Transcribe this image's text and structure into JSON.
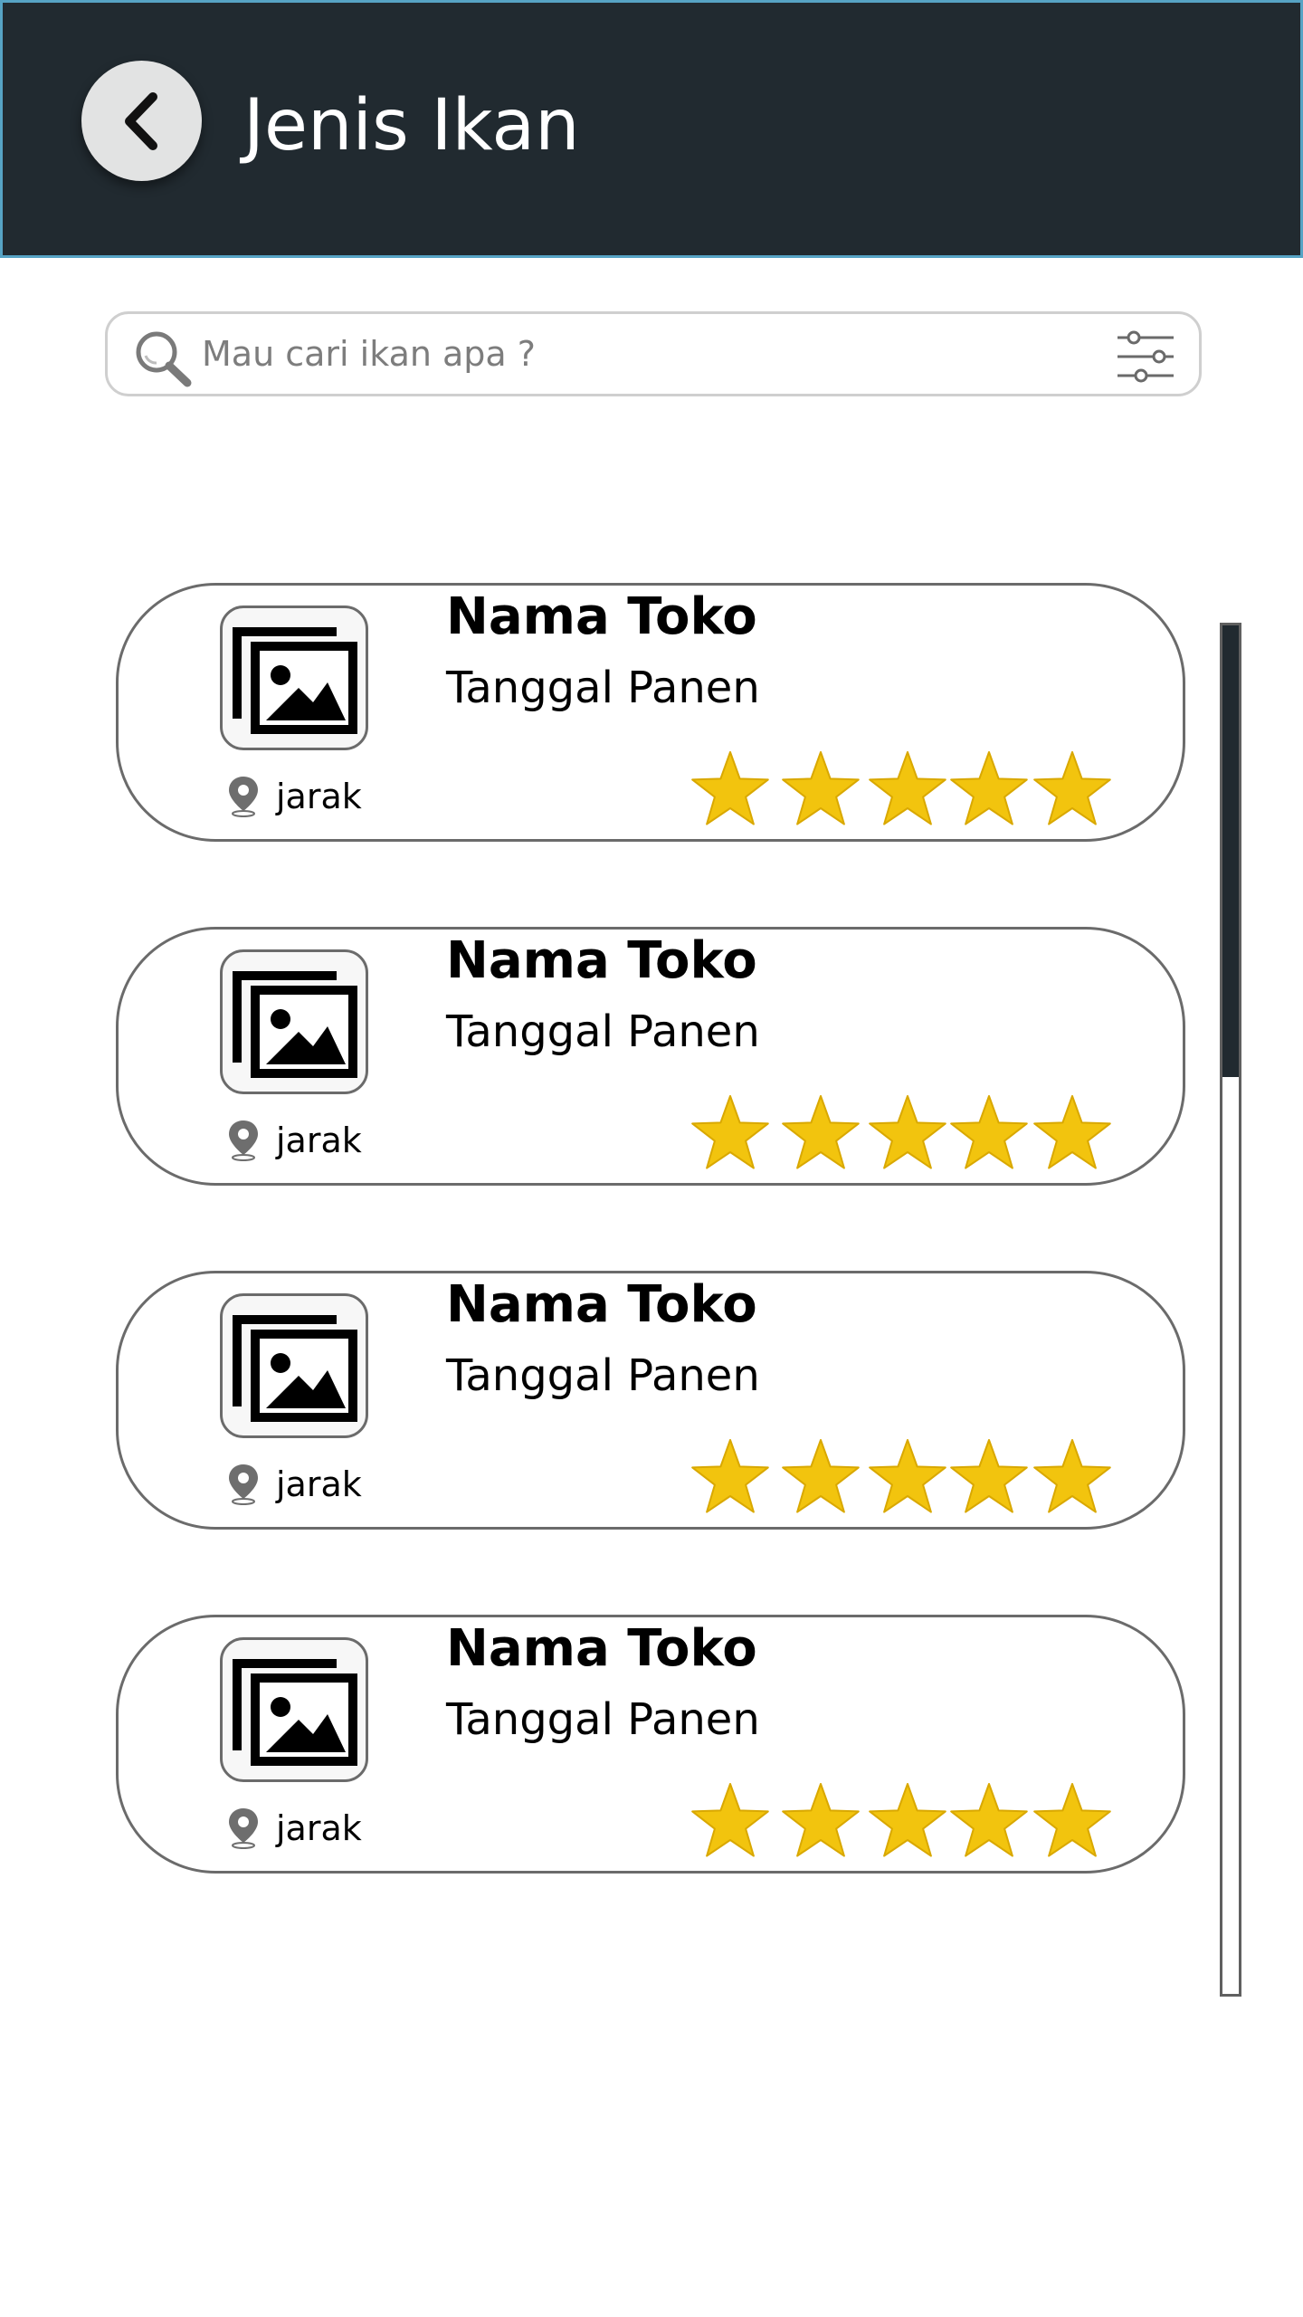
{
  "header": {
    "title": "Jenis Ikan",
    "background_color": "#212a30",
    "border_color": "#56a3c4",
    "back_icon": "chevron-left-icon"
  },
  "search": {
    "placeholder": "Mau cari ikan apa ?",
    "value": "",
    "icon": "search-icon",
    "filter_icon": "sliders-icon"
  },
  "stores": [
    {
      "name": "Nama Toko",
      "harvest_date": "Tanggal Panen",
      "distance": "jarak",
      "rating": 5,
      "image_icon": "image-gallery-icon",
      "location_icon": "map-pin-icon"
    },
    {
      "name": "Nama Toko",
      "harvest_date": "Tanggal Panen",
      "distance": "jarak",
      "rating": 5,
      "image_icon": "image-gallery-icon",
      "location_icon": "map-pin-icon"
    },
    {
      "name": "Nama Toko",
      "harvest_date": "Tanggal Panen",
      "distance": "jarak",
      "rating": 5,
      "image_icon": "image-gallery-icon",
      "location_icon": "map-pin-icon"
    },
    {
      "name": "Nama Toko",
      "harvest_date": "Tanggal Panen",
      "distance": "jarak",
      "rating": 5,
      "image_icon": "image-gallery-icon",
      "location_icon": "map-pin-icon"
    }
  ],
  "rating_max": 5,
  "star_color": "#f2c40e",
  "scrollbar": {
    "visible_fraction": 0.33,
    "scroll_position": 0
  }
}
